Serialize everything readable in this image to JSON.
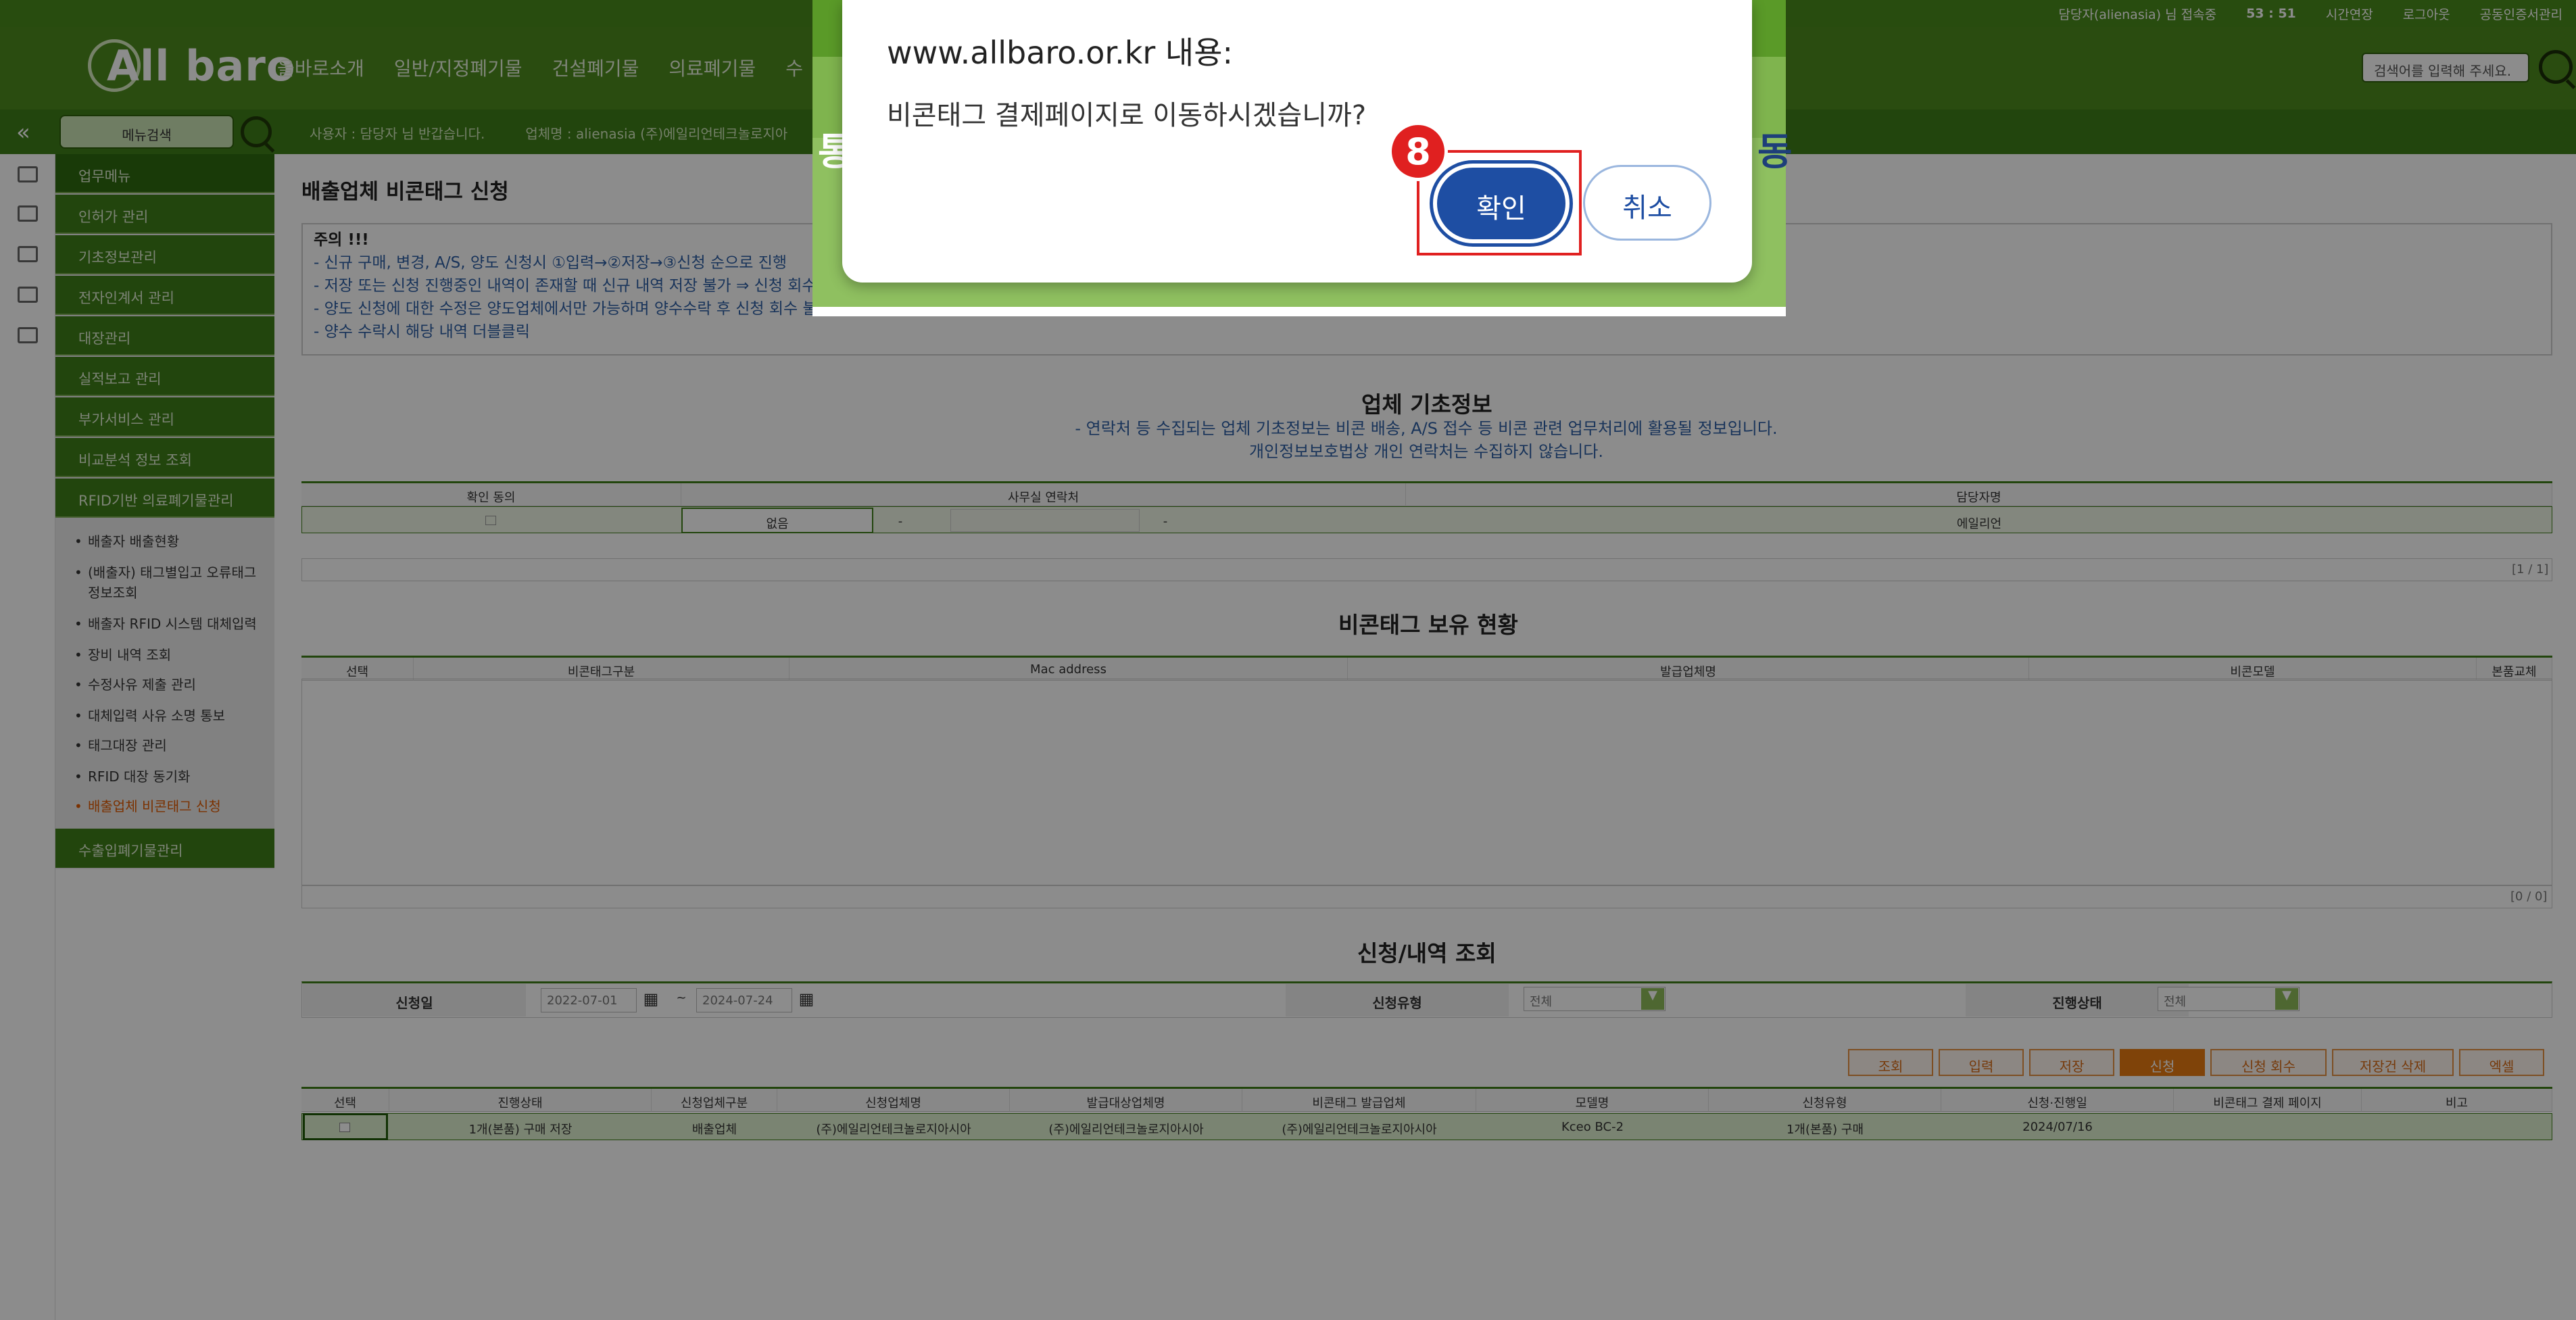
{
  "header": {
    "logo": "All baro",
    "gnb": [
      "올바로소개",
      "일반/지정폐기물",
      "건설폐기물",
      "의료폐기물",
      "수"
    ],
    "util": [
      "담당자(alienasia) 님 접속중",
      "53 : 51",
      "시간연장",
      "로그아웃",
      "공동인증서관리"
    ],
    "search_placeholder": "검색어를 입력해 주세요."
  },
  "subbar": {
    "menu_search": "메뉴검색",
    "user_text": "사용자 : 담당자 님 반갑습니다.",
    "company_text": "업체명 : alienasia (주)에일리언테크놀로지아"
  },
  "sidebar": {
    "menus": [
      "업무메뉴",
      "인허가 관리",
      "기초정보관리",
      "전자인계서 관리",
      "대장관리",
      "실적보고 관리",
      "부가서비스 관리",
      "비교분석 정보 조회",
      "RFID기반 의료폐기물관리"
    ],
    "subs": [
      "배출자 배출현황",
      "(배출자) 태그별입고 오류태그 정보조회",
      "배출자 RFID 시스템 대체입력",
      "장비 내역 조회",
      "수정사유 제출 관리",
      "대체입력 사유 소명 통보",
      "태그대장 관리",
      "RFID 대장 동기화",
      "배출업체 비콘태그 신청"
    ],
    "bottom_menu": "수출입폐기물관리"
  },
  "page": {
    "title": "배출업체 비콘태그 신청",
    "notice_head": "주의 !!!",
    "notice_lines": [
      "- 신규 구매, 변경, A/S, 양도 신청시 ①입력→②저장→③신청 순으로 진행",
      "- 저장 또는 신청 진행중인 내역이 존재할 때 신규 내역 저장 불가 ⇒ 신청 회수",
      "- 양도 신청에 대한 수정은 양도업체에서만 가능하며 양수수락 후 신청 회수 불",
      "- 양수 수락시 해당 내역 더블클릭"
    ]
  },
  "company": {
    "title": "업체 기초정보",
    "note1": "- 연락처 등 수집되는 업체 기초정보는 비콘 배송, A/S 접수 등 비콘 관련 업무처리에 활용될 정보입니다.",
    "note2": "개인정보보호법상 개인 연락처는 수집하지 않습니다.",
    "headers": [
      "확인 동의",
      "사무실 연락처",
      "담당자명"
    ],
    "office_select": "없음",
    "dash1": "-",
    "dash2": "-",
    "manager": "에일리언",
    "pager": "[1 / 1]"
  },
  "beacon": {
    "title": "비콘태그 보유 현황",
    "headers": [
      "선택",
      "비콘태그구분",
      "Mac address",
      "발급업체명",
      "비콘모델",
      "본품교체"
    ],
    "pager": "[0 / 0]"
  },
  "history": {
    "title": "신청/내역 조회",
    "date_label": "신청일",
    "date_from": "2022-07-01",
    "date_sep": "~",
    "date_to": "2024-07-24",
    "type_label": "신청유형",
    "type_value": "전체",
    "status_label": "진행상태",
    "status_value": "전체",
    "buttons": [
      "조회",
      "입력",
      "저장",
      "신청",
      "신청 회수",
      "저장건 삭제",
      "엑셀"
    ],
    "headers": [
      "선택",
      "진행상태",
      "신청업체구분",
      "신청업체명",
      "발급대상업체명",
      "비콘태그 발급업체",
      "모델명",
      "신청유형",
      "신청·진행일",
      "비콘태그 결제 페이지",
      "비고"
    ],
    "row": [
      "",
      "1개(본품) 구매 저장",
      "배출업체",
      "(주)에일리언테크놀로지아시아",
      "(주)에일리언테크놀로지아시아",
      "(주)에일리언테크놀로지아시아",
      "Kceo BC-2",
      "1개(본품) 구매",
      "2024/07/16",
      "",
      ""
    ]
  },
  "dialog": {
    "title": "www.allbaro.or.kr 내용:",
    "message": "비콘태그 결제페이지로 이동하시겠습니까?",
    "ok": "확인",
    "cancel": "취소",
    "step": "8",
    "bg_left": "통",
    "bg_right": "동"
  }
}
